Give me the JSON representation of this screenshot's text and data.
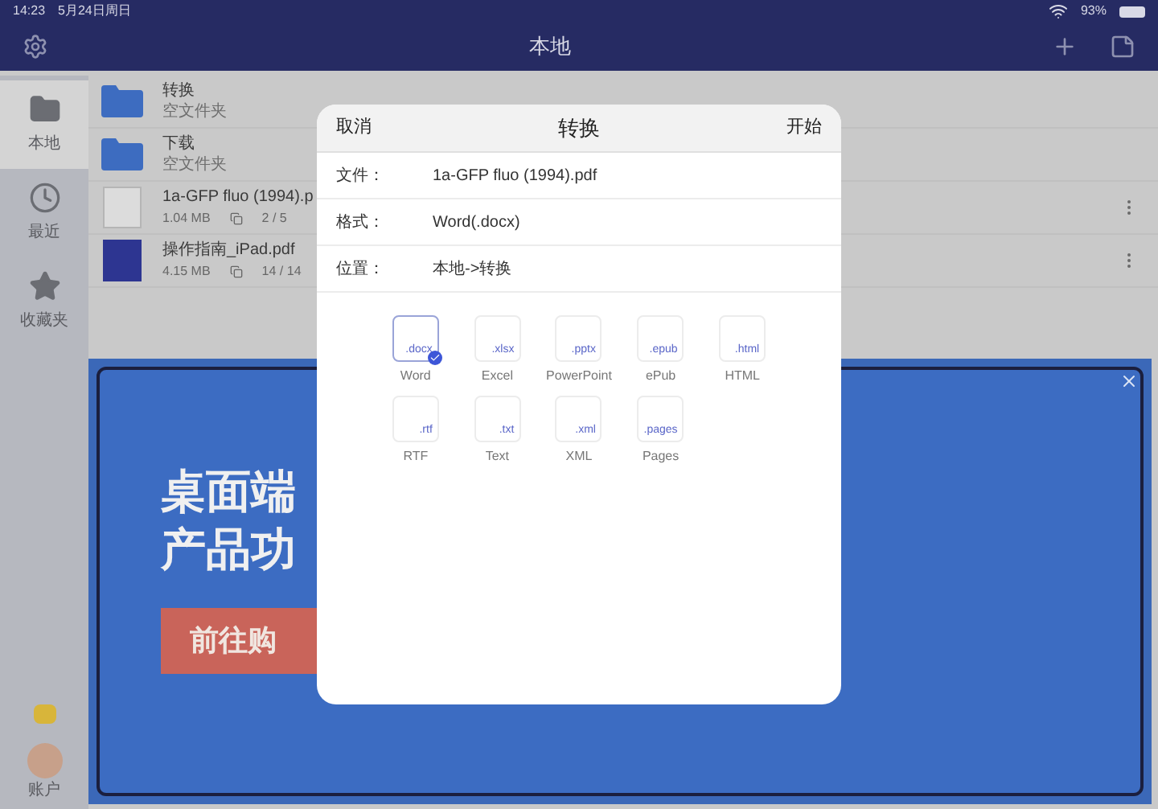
{
  "status_bar": {
    "time": "14:23",
    "date": "5月24日周日",
    "battery": "93%"
  },
  "header": {
    "title": "本地"
  },
  "sidebar": {
    "items": [
      {
        "label": "本地",
        "kind": "folder",
        "selected": true
      },
      {
        "label": "最近",
        "kind": "clock",
        "selected": false
      },
      {
        "label": "收藏夹",
        "kind": "star",
        "selected": false
      }
    ],
    "account": {
      "label": "账户"
    }
  },
  "files": [
    {
      "kind": "folder",
      "name": "转换",
      "subtitle": "空文件夹"
    },
    {
      "kind": "folder",
      "name": "下载",
      "subtitle": "空文件夹"
    },
    {
      "kind": "document",
      "name": "1a-GFP fluo (1994).p",
      "size": "1.04 MB",
      "pages": "2 / 5"
    },
    {
      "kind": "cover",
      "name": "操作指南_iPad.pdf",
      "size": "4.15 MB",
      "pages": "14 / 14"
    }
  ],
  "banner": {
    "line_1": "桌面端",
    "line_2": "产品功",
    "cta": "前往购"
  },
  "dialog": {
    "cancel": "取消",
    "title": "转换",
    "start": "开始",
    "fields": [
      {
        "label": "文件：",
        "value": "1a-GFP fluo (1994).pdf"
      },
      {
        "label": "格式：",
        "value": "Word(.docx)"
      },
      {
        "label": "位置：",
        "value": "本地->转换"
      }
    ],
    "formats": [
      {
        "label": "Word",
        "ext": ".docx",
        "selected": true
      },
      {
        "label": "Excel",
        "ext": ".xlsx",
        "selected": false
      },
      {
        "label": "PowerPoint",
        "ext": ".pptx",
        "selected": false
      },
      {
        "label": "ePub",
        "ext": ".epub",
        "selected": false
      },
      {
        "label": "HTML",
        "ext": ".html",
        "selected": false
      },
      {
        "label": "RTF",
        "ext": ".rtf",
        "selected": false
      },
      {
        "label": "Text",
        "ext": ".txt",
        "selected": false
      },
      {
        "label": "XML",
        "ext": ".xml",
        "selected": false
      },
      {
        "label": "Pages",
        "ext": ".pages",
        "selected": false
      }
    ]
  }
}
